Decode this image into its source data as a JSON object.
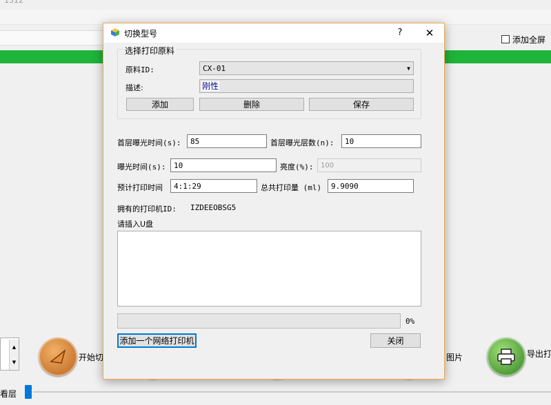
{
  "background": {
    "title_fragment": "1312",
    "fullscreen_label": "添加全屏",
    "start_label": "开始切",
    "image_label": "图片",
    "export_label": "导出打",
    "slider_label": "看层",
    "spinner_up": "▲",
    "spinner_down": "▼"
  },
  "dialog": {
    "title": "切换型号",
    "help": "?",
    "close_glyph": "✕",
    "material_group": {
      "legend": "选择打印原料",
      "id_label": "原料ID:",
      "id_value": "CX-01",
      "desc_label": "描述:",
      "desc_value": "刚性",
      "add_button": "添加",
      "delete_button": "删除",
      "save_button": "保存"
    },
    "params": {
      "first_exposure_label": "首层曝光时间(s):",
      "first_exposure_value": "85",
      "first_layers_label": "首层曝光层数(n):",
      "first_layers_value": "10",
      "exposure_label": "曝光时间(s):",
      "exposure_value": "10",
      "brightness_label": "亮度(%):",
      "brightness_value": "100",
      "est_time_label": "预计打印时间",
      "est_time_value": "4:1:29",
      "total_amount_label": "总共打印量 (ml)",
      "total_amount_value": "9.9090"
    },
    "printer_id_label": "拥有的打印机ID:",
    "printer_id_value": "IZDEEOBSG5",
    "usb_prompt": "请插入U盘",
    "progress_percent": 0,
    "progress_text": "0%",
    "add_network_printer": "添加一个网络打印机",
    "close_button": "关闭"
  },
  "colors": {
    "accent": "#0078d7",
    "progress_green": "#1fb43a",
    "dialog_border": "#f0a64f"
  }
}
